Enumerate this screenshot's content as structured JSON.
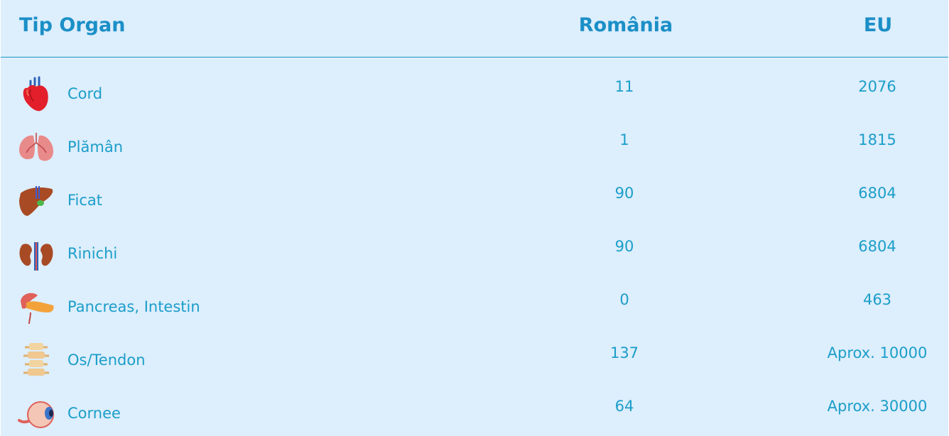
{
  "headers": {
    "organ": "Tip Organ",
    "romania": "România",
    "eu": "EU"
  },
  "rows": [
    {
      "name": "Cord",
      "romania": "11",
      "eu": "2076",
      "icon": "heart-icon"
    },
    {
      "name": "Plămân",
      "romania": "1",
      "eu": "1815",
      "icon": "lungs-icon"
    },
    {
      "name": "Ficat",
      "romania": "90",
      "eu": "6804",
      "icon": "liver-icon"
    },
    {
      "name": "Rinichi",
      "romania": "90",
      "eu": "6804",
      "icon": "kidneys-icon"
    },
    {
      "name": "Pancreas, Intestin",
      "romania": "0",
      "eu": "463",
      "icon": "pancreas-icon"
    },
    {
      "name": "Os/Tendon",
      "romania": "137",
      "eu": "Aprox. 10000",
      "icon": "bone-icon"
    },
    {
      "name": "Cornee",
      "romania": "64",
      "eu": "Aprox. 30000",
      "icon": "eye-icon"
    }
  ],
  "colors": {
    "background": "#ddeefc",
    "header_text": "#1b8fc7",
    "cell_text": "#1b9ec9",
    "divider": "#1a97c4"
  }
}
